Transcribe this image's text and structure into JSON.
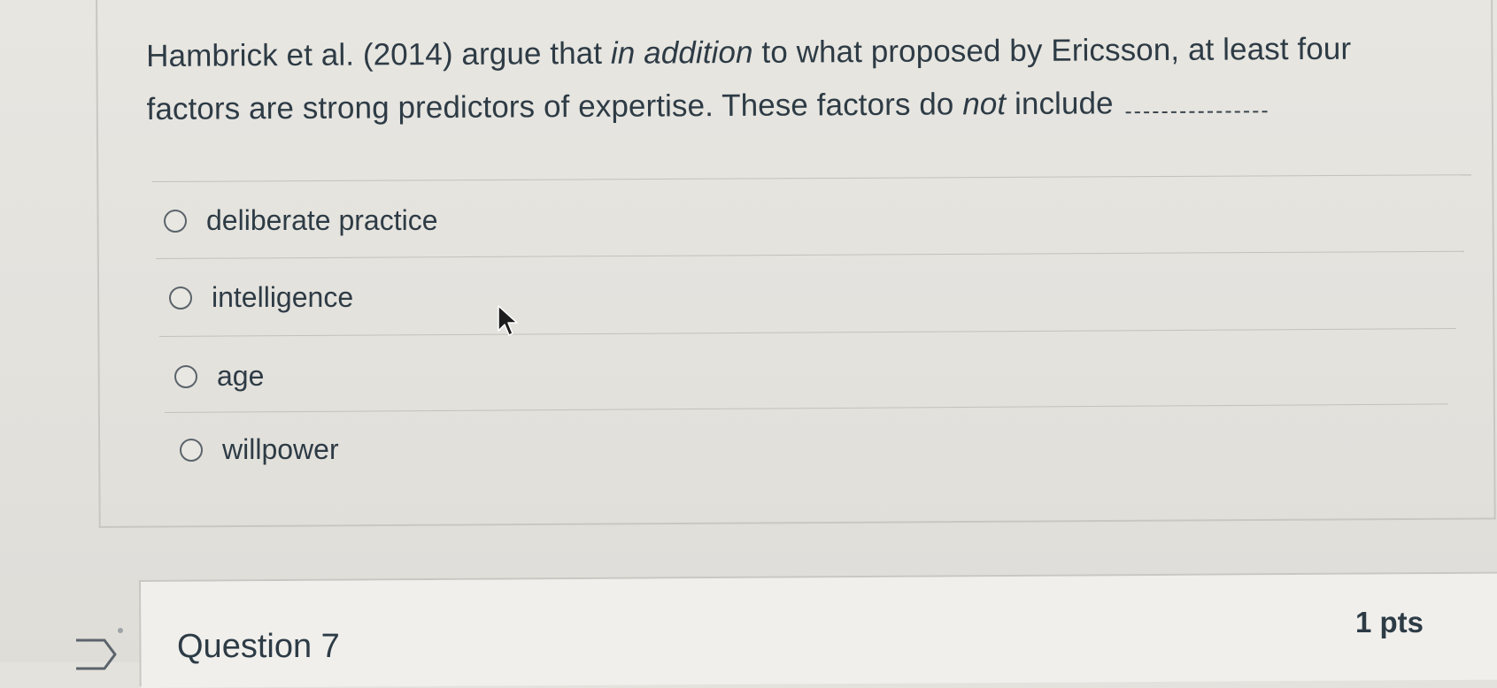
{
  "question": {
    "text_part1": "Hambrick et al. (2014) argue that ",
    "text_italic1": "in addition",
    "text_part2": " to what proposed by Ericsson, at least four factors are strong predictors of expertise. These factors do ",
    "text_italic2": "not",
    "text_part3": " include ",
    "answers": [
      {
        "label": "deliberate practice",
        "selected": false
      },
      {
        "label": "intelligence",
        "selected": false
      },
      {
        "label": "age",
        "selected": false
      },
      {
        "label": "willpower",
        "selected": false
      }
    ]
  },
  "next_question": {
    "title": "Question 7",
    "points": "1 pts",
    "flag_icon": "flag-icon"
  },
  "colors": {
    "background": "#e4e2dd",
    "text": "#2d3b45",
    "border": "#c9c7c2"
  }
}
